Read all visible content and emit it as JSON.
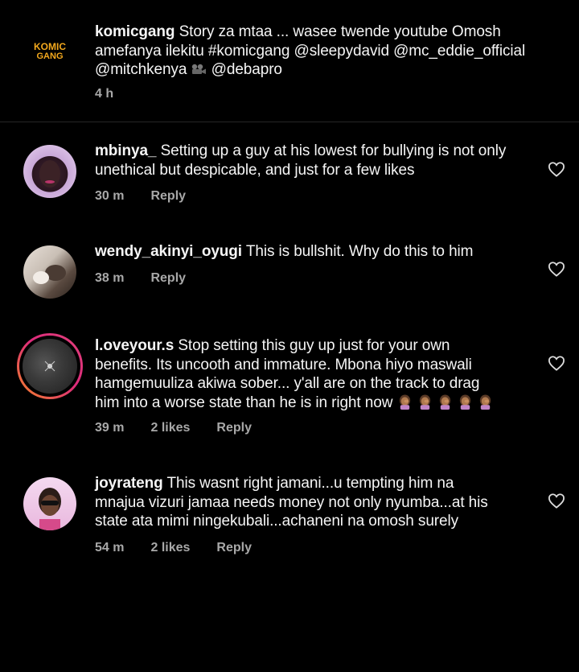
{
  "post": {
    "username": "komicgang",
    "caption_1": "Story za mtaa ... wasee twende youtube Omosh",
    "caption_2": "amefanya ilekitu #komicgang @sleepydavid @mc_eddie_official",
    "caption_3a": "@mitchkenya",
    "caption_3b": "@debapro",
    "time": "4 h",
    "logo_text_1": "KOMIC",
    "logo_text_2": "GANG"
  },
  "comments": [
    {
      "username": "mbinya_",
      "lines": [
        "Setting up a guy at his lowest for bullying is not only",
        "unethical but despicable, and just for a few likes"
      ],
      "time": "30 m",
      "reply": "Reply"
    },
    {
      "username": "wendy_akinyi_oyugi",
      "lines": [
        "This is bullshit. Why do this to him"
      ],
      "time": "38 m",
      "reply": "Reply"
    },
    {
      "username": "l.oveyour.s",
      "lines": [
        "Stop setting this guy up just for your own",
        "benefits. Its uncooth and immature. Mbona hiyo maswali",
        "hamgemuuliza akiwa sober... y'all are on the track to drag",
        "him into a worse state than he is in right now"
      ],
      "time": "39 m",
      "likes": "2 likes",
      "reply": "Reply"
    },
    {
      "username": "joyrateng",
      "lines": [
        "This wasnt right jamani...u tempting him na",
        "mnajua vizuri jamaa needs money not only nyumba...at his",
        "state ata mimi ningekubali...achaneni na omosh surely"
      ],
      "time": "54 m",
      "likes": "2 likes",
      "reply": "Reply"
    }
  ],
  "icons": {
    "like": "heart-outline-icon",
    "camera": "movie-camera-icon",
    "emoji": "woman-facepalming-icon"
  },
  "colors": {
    "background": "#000000",
    "text": "#f5f5f5",
    "meta": "#a8a8a8",
    "story_ring": "#e0427a",
    "logo": "#f2a81d"
  }
}
